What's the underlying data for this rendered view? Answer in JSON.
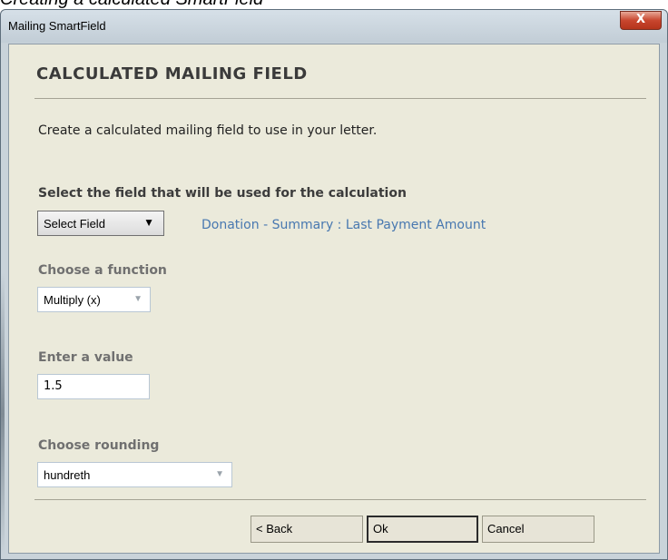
{
  "caption": "Creating a calculated SmartField",
  "window": {
    "title": "Mailing SmartField",
    "close_glyph": "X"
  },
  "dialog": {
    "heading": "CALCULATED MAILING FIELD",
    "description": "Create a calculated mailing field to use in your letter.",
    "field_section": {
      "label": "Select the field that will be used for the calculation",
      "select_value": "Select Field",
      "selected_field_text": "Donation - Summary : Last Payment Amount"
    },
    "function_section": {
      "label": "Choose a function",
      "select_value": "Multiply (x)"
    },
    "value_section": {
      "label": "Enter a value",
      "input_value": "1.5"
    },
    "rounding_section": {
      "label": "Choose rounding",
      "select_value": "hundreth"
    },
    "buttons": {
      "back": "< Back",
      "ok": "Ok",
      "cancel": "Cancel"
    }
  },
  "icons": {
    "dropdown_dark": "chevron-down-icon",
    "dropdown_light": "chevron-down-icon"
  },
  "colors": {
    "panel_background": "#ebeadb",
    "link_text": "#4878b0",
    "close_button": "#c8462e"
  }
}
